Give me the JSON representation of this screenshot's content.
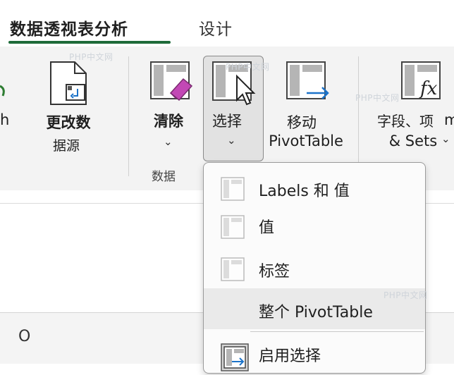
{
  "tabs": {
    "analyze": "数据透视表分析",
    "design": "设计"
  },
  "ribbon": {
    "left_partial": "h",
    "change_source": {
      "line1": "更改数",
      "line2": "据源"
    },
    "clear": {
      "label": "清除"
    },
    "select": {
      "label": "选择"
    },
    "move": {
      "line1": "移动",
      "line2": "PivotTable"
    },
    "fields": {
      "line1": "字段、项",
      "line2": "& Sets"
    },
    "right_partial": "m",
    "group_data": "数据"
  },
  "select_menu": {
    "items": [
      {
        "label": "Labels 和 值",
        "icon": "labels-and-values-icon"
      },
      {
        "label": "值",
        "icon": "values-icon"
      },
      {
        "label": "标签",
        "icon": "labels-icon"
      },
      {
        "label": "整个  PivotTable",
        "icon": ""
      },
      {
        "label": "启用选择",
        "icon": "enable-selection-icon"
      }
    ]
  },
  "sheet": {
    "column_letter": "O"
  },
  "watermark": "PHP中文网",
  "colors": {
    "accent_green": "#1e6b3a",
    "clear_pink": "#c248b5",
    "move_arrow": "#1c73c9"
  }
}
